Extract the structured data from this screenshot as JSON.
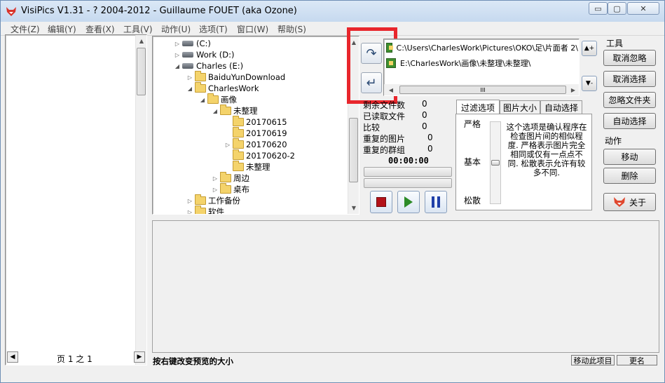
{
  "window": {
    "title": "VisiPics V1.31 - ? 2004-2012 - Guillaume FOUET (aka Ozone)",
    "minimize_glyph": "▭",
    "maximize_glyph": "▢",
    "close_glyph": "✕"
  },
  "menu": [
    {
      "label": "文件(Z)"
    },
    {
      "label": "编辑(Y)"
    },
    {
      "label": "查看(X)"
    },
    {
      "label": "工具(V)"
    },
    {
      "label": "动作(U)"
    },
    {
      "label": "选项(T)"
    },
    {
      "label": "窗口(W)"
    },
    {
      "label": "帮助(S)"
    }
  ],
  "tree": [
    {
      "label": "(C:)",
      "type": "drive"
    },
    {
      "label": "Work (D:)",
      "type": "drive"
    },
    {
      "label": "Charles (E:)",
      "type": "drive"
    },
    {
      "label": "BaiduYunDownload",
      "type": "folder"
    },
    {
      "label": "CharlesWork",
      "type": "folder"
    },
    {
      "label": "画像",
      "type": "folder"
    },
    {
      "label": "未整理",
      "type": "folder"
    },
    {
      "label": "20170615",
      "type": "folder"
    },
    {
      "label": "20170619",
      "type": "folder"
    },
    {
      "label": "20170620",
      "type": "folder"
    },
    {
      "label": "20170620-2",
      "type": "folder"
    },
    {
      "label": "未整理",
      "type": "folder"
    },
    {
      "label": "周边",
      "type": "folder"
    },
    {
      "label": "桌布",
      "type": "folder"
    },
    {
      "label": "工作备份",
      "type": "folder"
    },
    {
      "label": "软件",
      "type": "folder"
    }
  ],
  "paths": [
    {
      "text": "C:\\Users\\CharlesWork\\Pictures\\OKO\\足\\片面者 2\\"
    },
    {
      "text": "E:\\CharlesWork\\画像\\未整理\\未整理\\"
    }
  ],
  "nav_glyphs": {
    "add": "↷",
    "remove": "↵",
    "hscroll_thumb": "III"
  },
  "stats": [
    {
      "label": "剩余文件数",
      "value": "0"
    },
    {
      "label": "已读取文件",
      "value": "0"
    },
    {
      "label": "比较",
      "value": "0"
    },
    {
      "label": "重复的图片",
      "value": "0"
    },
    {
      "label": "重复的群组",
      "value": "0"
    }
  ],
  "timer": "00:00:00",
  "tabs": [
    {
      "label": "过滤选项",
      "active": true
    },
    {
      "label": "图片大小",
      "active": false
    },
    {
      "label": "自动选择",
      "active": false
    }
  ],
  "filter": {
    "levels": [
      "严格",
      "基本",
      "松散"
    ],
    "description": "这个选项是确认程序在检查图片间的相似程度. 严格表示图片完全相同或仅有一点点不同. 松散表示允许有较多不同."
  },
  "tools": {
    "section_label": "工具",
    "buttons": [
      "取消忽略",
      "取消选择",
      "忽略文件夹",
      "自动选择"
    ]
  },
  "actions": {
    "section_label": "动作",
    "buttons": [
      "移动",
      "删除"
    ],
    "about_label": "关于"
  },
  "status": {
    "page_text": "页 1 之 1",
    "hint": "按右键改变预览的大小",
    "move_label": "移动此项目",
    "rename_label": "更名"
  },
  "colors": {
    "highlight": "#e8262c",
    "stop": "#b3121a",
    "play": "#2c8b27",
    "pause": "#1f3fa8"
  }
}
